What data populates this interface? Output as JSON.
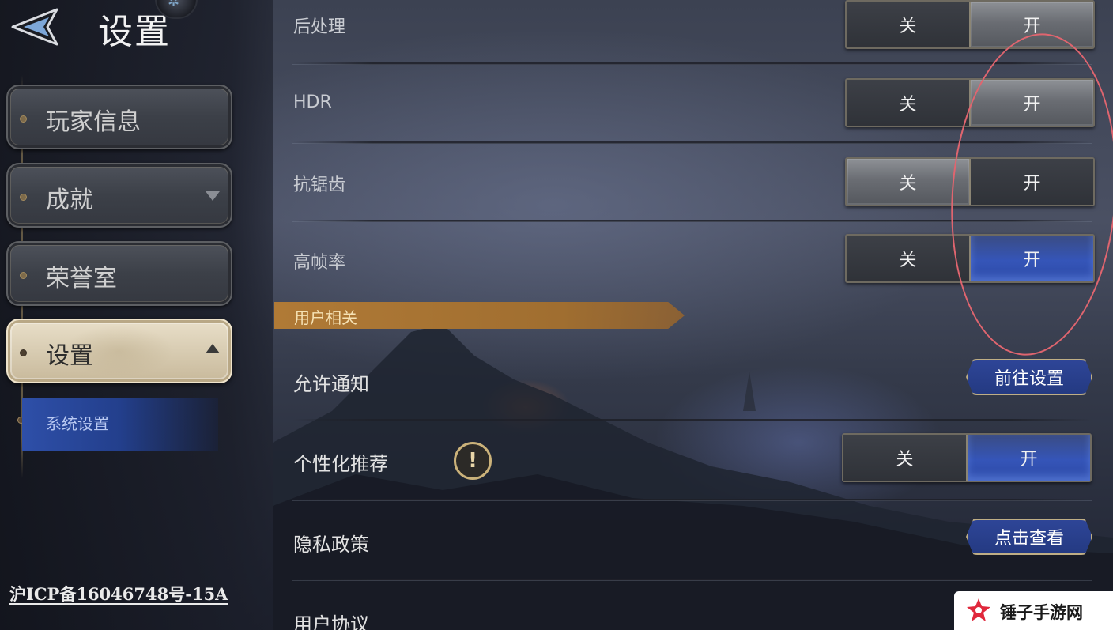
{
  "header": {
    "title": "设置"
  },
  "sidebar": {
    "items": [
      {
        "label": "玩家信息"
      },
      {
        "label": "成就"
      },
      {
        "label": "荣誉室"
      },
      {
        "label": "设置"
      }
    ],
    "subitem": {
      "label": "系统设置"
    },
    "icp": "沪ICP备16046748号-15A"
  },
  "settings": {
    "graphics": [
      {
        "label": "后处理",
        "off": "关",
        "on": "开",
        "value": "on"
      },
      {
        "label": "HDR",
        "off": "关",
        "on": "开",
        "value": "on"
      },
      {
        "label": "抗锯齿",
        "off": "关",
        "on": "开",
        "value": "off"
      },
      {
        "label": "高帧率",
        "off": "关",
        "on": "开",
        "value": "on"
      }
    ],
    "user_section": {
      "label": "用户相关"
    },
    "notify": {
      "label": "允许通知",
      "button": "前往设置"
    },
    "personalized": {
      "label": "个性化推荐",
      "info": "!",
      "off": "关",
      "on": "开",
      "value": "on"
    },
    "privacy": {
      "label": "隐私政策",
      "button": "点击查看"
    },
    "agreement": {
      "label": "用户协议"
    }
  },
  "watermark": {
    "text": "锤子手游网"
  },
  "colors": {
    "accent_blue": "#3555b8",
    "section_gold": "#b07a36",
    "annotation_red": "#e0656f"
  }
}
